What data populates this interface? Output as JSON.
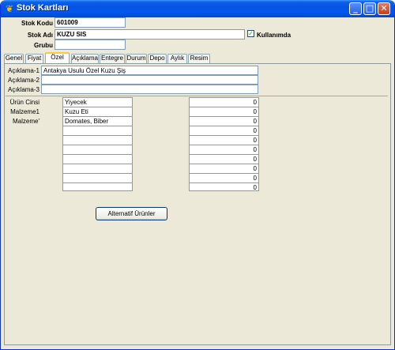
{
  "window": {
    "title": "Stok Kartları",
    "app_icon": "butterfly-icon",
    "buttons": {
      "minimize": "_",
      "maximize": "□",
      "close": "✕"
    }
  },
  "header": {
    "code_label": "Stok Kodu",
    "code_value": "601009",
    "name_label": "Stok Adı",
    "name_value": "KUZU SIS",
    "group_label": "Grubu",
    "group_value": "",
    "in_use_label": "Kullanımda",
    "in_use_checked": true,
    "check_mark": "✓"
  },
  "tabs": [
    {
      "label": "Genel"
    },
    {
      "label": "Fiyat"
    },
    {
      "label": "Özel"
    },
    {
      "label": "Açıklama"
    },
    {
      "label": "Entegre"
    },
    {
      "label": "Durum"
    },
    {
      "label": "Depo"
    },
    {
      "label": "Aylık"
    },
    {
      "label": "Resim"
    }
  ],
  "active_tab": "Özel",
  "descriptions": [
    {
      "label": "Açıklama-1",
      "value": "Antakya Usulu Özel Kuzu Şiş"
    },
    {
      "label": "Açıklama-2",
      "value": ""
    },
    {
      "label": "Açıklama-3",
      "value": ""
    }
  ],
  "attributes": {
    "labels": [
      "Ürün Cinsi",
      "Malzeme1",
      "Malzeme'"
    ],
    "values": [
      "Yiyecek",
      "Kuzu Eti",
      "Domates, Biber",
      "",
      "",
      "",
      "",
      "",
      "",
      ""
    ],
    "numbers": [
      "0",
      "0",
      "0",
      "0",
      "0",
      "0",
      "0",
      "0",
      "0",
      "0"
    ]
  },
  "alt_products_button": "Alternatif Ürünler"
}
